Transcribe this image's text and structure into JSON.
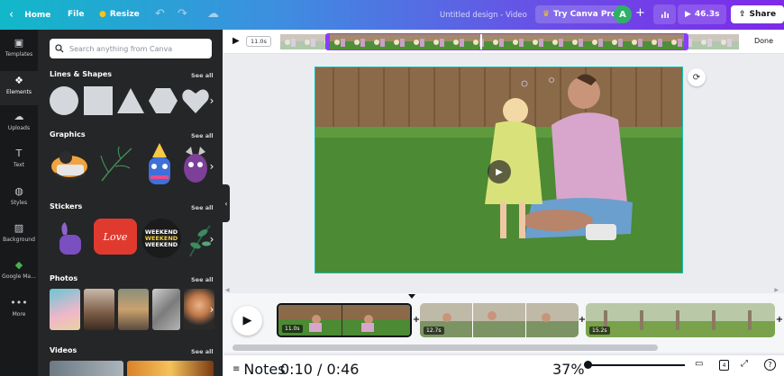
{
  "topbar": {
    "home": "Home",
    "file": "File",
    "resize": "Resize",
    "design_title": "Untitled design - Video",
    "try_pro": "Try Canva Pro",
    "avatar_letter": "A",
    "duration": "46.3s",
    "share": "Share"
  },
  "rail": {
    "items": [
      {
        "label": "Templates",
        "icon": "templates-icon"
      },
      {
        "label": "Elements",
        "icon": "elements-icon"
      },
      {
        "label": "Uploads",
        "icon": "uploads-icon"
      },
      {
        "label": "Text",
        "icon": "text-icon"
      },
      {
        "label": "Styles",
        "icon": "styles-icon"
      },
      {
        "label": "Background",
        "icon": "background-icon"
      },
      {
        "label": "Google Ma...",
        "icon": "google-maps-icon"
      },
      {
        "label": "More",
        "icon": "more-icon"
      }
    ]
  },
  "panel": {
    "search_placeholder": "Search anything from Canva",
    "see_all": "See all",
    "sections": {
      "lines": "Lines & Shapes",
      "graphics": "Graphics",
      "stickers": "Stickers",
      "photos": "Photos",
      "videos": "Videos"
    },
    "sticker_love": "Love",
    "sticker_weekend": "WEEKEND"
  },
  "scrubber": {
    "time_chip": "11.0s",
    "done": "Done"
  },
  "timeline": {
    "clips": [
      {
        "duration": "11.0s"
      },
      {
        "duration": "12.7s"
      },
      {
        "duration": "15.2s"
      }
    ]
  },
  "bottom": {
    "notes": "Notes",
    "time": "0:10 / 0:46",
    "zoom": "37%",
    "page_count": "4"
  },
  "colors": {
    "accent_purple": "#8b3dff",
    "canvas_border": "#13c2b3",
    "panel_bg": "#252627"
  }
}
